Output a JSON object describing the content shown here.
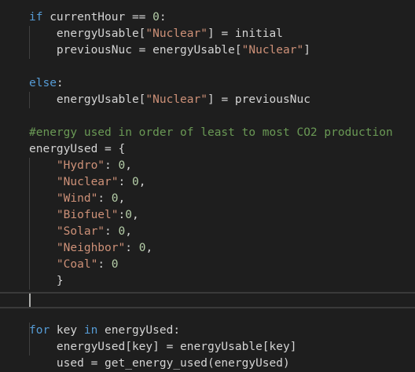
{
  "editor": {
    "lines": [
      [
        {
          "t": "kw",
          "v": "if"
        },
        {
          "t": "plain",
          "v": " currentHour == "
        },
        {
          "t": "num",
          "v": "0"
        },
        {
          "t": "plain",
          "v": ":"
        }
      ],
      [
        {
          "t": "plain",
          "v": "    energyUsable["
        },
        {
          "t": "str",
          "v": "\"Nuclear\""
        },
        {
          "t": "plain",
          "v": "] = initial"
        }
      ],
      [
        {
          "t": "plain",
          "v": "    previousNuc = energyUsable["
        },
        {
          "t": "str",
          "v": "\"Nuclear\""
        },
        {
          "t": "plain",
          "v": "]"
        }
      ],
      [],
      [
        {
          "t": "kw",
          "v": "else"
        },
        {
          "t": "plain",
          "v": ":"
        }
      ],
      [
        {
          "t": "plain",
          "v": "    energyUsable["
        },
        {
          "t": "str",
          "v": "\"Nuclear\""
        },
        {
          "t": "plain",
          "v": "] = previousNuc"
        }
      ],
      [],
      [
        {
          "t": "cmt",
          "v": "#energy used in order of least to most CO2 production"
        }
      ],
      [
        {
          "t": "plain",
          "v": "energyUsed = {"
        }
      ],
      [
        {
          "t": "plain",
          "v": "    "
        },
        {
          "t": "str",
          "v": "\"Hydro\""
        },
        {
          "t": "plain",
          "v": ": "
        },
        {
          "t": "num",
          "v": "0"
        },
        {
          "t": "plain",
          "v": ","
        }
      ],
      [
        {
          "t": "plain",
          "v": "    "
        },
        {
          "t": "str",
          "v": "\"Nuclear\""
        },
        {
          "t": "plain",
          "v": ": "
        },
        {
          "t": "num",
          "v": "0"
        },
        {
          "t": "plain",
          "v": ","
        }
      ],
      [
        {
          "t": "plain",
          "v": "    "
        },
        {
          "t": "str",
          "v": "\"Wind\""
        },
        {
          "t": "plain",
          "v": ": "
        },
        {
          "t": "num",
          "v": "0"
        },
        {
          "t": "plain",
          "v": ","
        }
      ],
      [
        {
          "t": "plain",
          "v": "    "
        },
        {
          "t": "str",
          "v": "\"Biofuel\""
        },
        {
          "t": "plain",
          "v": ":"
        },
        {
          "t": "num",
          "v": "0"
        },
        {
          "t": "plain",
          "v": ","
        }
      ],
      [
        {
          "t": "plain",
          "v": "    "
        },
        {
          "t": "str",
          "v": "\"Solar\""
        },
        {
          "t": "plain",
          "v": ": "
        },
        {
          "t": "num",
          "v": "0"
        },
        {
          "t": "plain",
          "v": ","
        }
      ],
      [
        {
          "t": "plain",
          "v": "    "
        },
        {
          "t": "str",
          "v": "\"Neighbor\""
        },
        {
          "t": "plain",
          "v": ": "
        },
        {
          "t": "num",
          "v": "0"
        },
        {
          "t": "plain",
          "v": ","
        }
      ],
      [
        {
          "t": "plain",
          "v": "    "
        },
        {
          "t": "str",
          "v": "\"Coal\""
        },
        {
          "t": "plain",
          "v": ": "
        },
        {
          "t": "num",
          "v": "0"
        }
      ],
      [
        {
          "t": "plain",
          "v": "    }"
        }
      ],
      [],
      [],
      [
        {
          "t": "kw",
          "v": "for"
        },
        {
          "t": "plain",
          "v": " key "
        },
        {
          "t": "kw",
          "v": "in"
        },
        {
          "t": "plain",
          "v": " energyUsed:"
        }
      ],
      [
        {
          "t": "plain",
          "v": "    energyUsed[key] = energyUsable[key]"
        }
      ],
      [
        {
          "t": "plain",
          "v": "    used = get_energy_used(energyUsed)"
        }
      ]
    ]
  },
  "theme": {
    "background": "#1e1e1e",
    "keyword": "#569cd6",
    "string": "#ce9178",
    "number": "#b5cea8",
    "comment": "#6a9955",
    "text": "#d4d4d4"
  }
}
